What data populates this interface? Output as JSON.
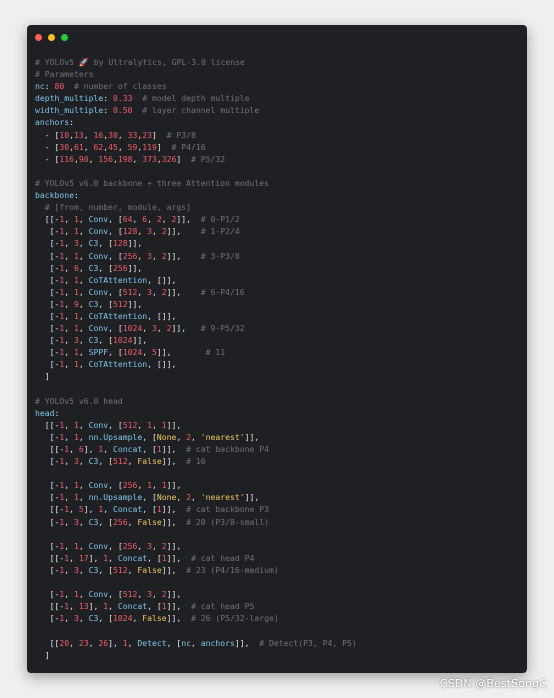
{
  "window": {
    "controls": [
      {
        "name": "close-dot",
        "color": "#ff5f56"
      },
      {
        "name": "minimize-dot",
        "color": "#ffbd2e"
      },
      {
        "name": "maximize-dot",
        "color": "#27c93f"
      }
    ]
  },
  "theme": {
    "background": "#1f2023",
    "comment": "#6f7379",
    "key": "#7fc6ee",
    "number": "#f25d67",
    "string": "#f0c75c",
    "text": "#e1e3e5"
  },
  "code_lines": [
    [
      [
        "c",
        "# YOLOv5 "
      ],
      [
        "e",
        "🚀"
      ],
      [
        "c",
        " by Ultralytics, GPL-3.0 license"
      ]
    ],
    [
      [
        "c",
        "# Parameters"
      ]
    ],
    [
      [
        "k",
        "nc"
      ],
      [
        "p",
        ": "
      ],
      [
        "n",
        "80"
      ],
      [
        "p",
        "  "
      ],
      [
        "c",
        "# number of classes"
      ]
    ],
    [
      [
        "k",
        "depth_multiple"
      ],
      [
        "p",
        ": "
      ],
      [
        "n",
        "0.33"
      ],
      [
        "p",
        "  "
      ],
      [
        "c",
        "# model depth multiple"
      ]
    ],
    [
      [
        "k",
        "width_multiple"
      ],
      [
        "p",
        ": "
      ],
      [
        "n",
        "0.50"
      ],
      [
        "p",
        "  "
      ],
      [
        "c",
        "# layer channel multiple"
      ]
    ],
    [
      [
        "k",
        "anchors"
      ],
      [
        "p",
        ":"
      ]
    ],
    [
      [
        "p",
        "  - ["
      ],
      [
        "n",
        "10"
      ],
      [
        "p",
        ","
      ],
      [
        "n",
        "13"
      ],
      [
        "p",
        ", "
      ],
      [
        "n",
        "16"
      ],
      [
        "p",
        ","
      ],
      [
        "n",
        "30"
      ],
      [
        "p",
        ", "
      ],
      [
        "n",
        "33"
      ],
      [
        "p",
        ","
      ],
      [
        "n",
        "23"
      ],
      [
        "p",
        "]  "
      ],
      [
        "c",
        "# P3/8"
      ]
    ],
    [
      [
        "p",
        "  - ["
      ],
      [
        "n",
        "30"
      ],
      [
        "p",
        ","
      ],
      [
        "n",
        "61"
      ],
      [
        "p",
        ", "
      ],
      [
        "n",
        "62"
      ],
      [
        "p",
        ","
      ],
      [
        "n",
        "45"
      ],
      [
        "p",
        ", "
      ],
      [
        "n",
        "59"
      ],
      [
        "p",
        ","
      ],
      [
        "n",
        "119"
      ],
      [
        "p",
        "]  "
      ],
      [
        "c",
        "# P4/16"
      ]
    ],
    [
      [
        "p",
        "  - ["
      ],
      [
        "n",
        "116"
      ],
      [
        "p",
        ","
      ],
      [
        "n",
        "90"
      ],
      [
        "p",
        ", "
      ],
      [
        "n",
        "156"
      ],
      [
        "p",
        ","
      ],
      [
        "n",
        "198"
      ],
      [
        "p",
        ", "
      ],
      [
        "n",
        "373"
      ],
      [
        "p",
        ","
      ],
      [
        "n",
        "326"
      ],
      [
        "p",
        "]  "
      ],
      [
        "c",
        "# P5/32"
      ]
    ],
    [],
    [
      [
        "c",
        "# YOLOv5 v6.0 backbone + three Attention modules"
      ]
    ],
    [
      [
        "k",
        "backbone"
      ],
      [
        "p",
        ":"
      ]
    ],
    [
      [
        "p",
        "  "
      ],
      [
        "c",
        "# [from, number, module, args]"
      ]
    ],
    [
      [
        "p",
        "  [[-"
      ],
      [
        "n",
        "1"
      ],
      [
        "p",
        ", "
      ],
      [
        "n",
        "1"
      ],
      [
        "p",
        ", "
      ],
      [
        "f",
        "Conv"
      ],
      [
        "p",
        ", ["
      ],
      [
        "n",
        "64"
      ],
      [
        "p",
        ", "
      ],
      [
        "n",
        "6"
      ],
      [
        "p",
        ", "
      ],
      [
        "n",
        "2"
      ],
      [
        "p",
        ", "
      ],
      [
        "n",
        "2"
      ],
      [
        "p",
        "]],  "
      ],
      [
        "c",
        "# 0-P1/2"
      ]
    ],
    [
      [
        "p",
        "   [-"
      ],
      [
        "n",
        "1"
      ],
      [
        "p",
        ", "
      ],
      [
        "n",
        "1"
      ],
      [
        "p",
        ", "
      ],
      [
        "f",
        "Conv"
      ],
      [
        "p",
        ", ["
      ],
      [
        "n",
        "128"
      ],
      [
        "p",
        ", "
      ],
      [
        "n",
        "3"
      ],
      [
        "p",
        ", "
      ],
      [
        "n",
        "2"
      ],
      [
        "p",
        "]],    "
      ],
      [
        "c",
        "# 1-P2/4"
      ]
    ],
    [
      [
        "p",
        "   [-"
      ],
      [
        "n",
        "1"
      ],
      [
        "p",
        ", "
      ],
      [
        "n",
        "3"
      ],
      [
        "p",
        ", "
      ],
      [
        "f",
        "C3"
      ],
      [
        "p",
        ", ["
      ],
      [
        "n",
        "128"
      ],
      [
        "p",
        "]],"
      ]
    ],
    [
      [
        "p",
        "   [-"
      ],
      [
        "n",
        "1"
      ],
      [
        "p",
        ", "
      ],
      [
        "n",
        "1"
      ],
      [
        "p",
        ", "
      ],
      [
        "f",
        "Conv"
      ],
      [
        "p",
        ", ["
      ],
      [
        "n",
        "256"
      ],
      [
        "p",
        ", "
      ],
      [
        "n",
        "3"
      ],
      [
        "p",
        ", "
      ],
      [
        "n",
        "2"
      ],
      [
        "p",
        "]],    "
      ],
      [
        "c",
        "# 3-P3/8"
      ]
    ],
    [
      [
        "p",
        "   [-"
      ],
      [
        "n",
        "1"
      ],
      [
        "p",
        ", "
      ],
      [
        "n",
        "6"
      ],
      [
        "p",
        ", "
      ],
      [
        "f",
        "C3"
      ],
      [
        "p",
        ", ["
      ],
      [
        "n",
        "256"
      ],
      [
        "p",
        "]],"
      ]
    ],
    [
      [
        "p",
        "   [-"
      ],
      [
        "n",
        "1"
      ],
      [
        "p",
        ", "
      ],
      [
        "n",
        "1"
      ],
      [
        "p",
        ", "
      ],
      [
        "f",
        "CoTAttention"
      ],
      [
        "p",
        ", []],"
      ]
    ],
    [
      [
        "p",
        "   [-"
      ],
      [
        "n",
        "1"
      ],
      [
        "p",
        ", "
      ],
      [
        "n",
        "1"
      ],
      [
        "p",
        ", "
      ],
      [
        "f",
        "Conv"
      ],
      [
        "p",
        ", ["
      ],
      [
        "n",
        "512"
      ],
      [
        "p",
        ", "
      ],
      [
        "n",
        "3"
      ],
      [
        "p",
        ", "
      ],
      [
        "n",
        "2"
      ],
      [
        "p",
        "]],    "
      ],
      [
        "c",
        "# 6-P4/16"
      ]
    ],
    [
      [
        "p",
        "   [-"
      ],
      [
        "n",
        "1"
      ],
      [
        "p",
        ", "
      ],
      [
        "n",
        "9"
      ],
      [
        "p",
        ", "
      ],
      [
        "f",
        "C3"
      ],
      [
        "p",
        ", ["
      ],
      [
        "n",
        "512"
      ],
      [
        "p",
        "]],"
      ]
    ],
    [
      [
        "p",
        "   [-"
      ],
      [
        "n",
        "1"
      ],
      [
        "p",
        ", "
      ],
      [
        "n",
        "1"
      ],
      [
        "p",
        ", "
      ],
      [
        "f",
        "CoTAttention"
      ],
      [
        "p",
        ", []],"
      ]
    ],
    [
      [
        "p",
        "   [-"
      ],
      [
        "n",
        "1"
      ],
      [
        "p",
        ", "
      ],
      [
        "n",
        "1"
      ],
      [
        "p",
        ", "
      ],
      [
        "f",
        "Conv"
      ],
      [
        "p",
        ", ["
      ],
      [
        "n",
        "1024"
      ],
      [
        "p",
        ", "
      ],
      [
        "n",
        "3"
      ],
      [
        "p",
        ", "
      ],
      [
        "n",
        "2"
      ],
      [
        "p",
        "]],   "
      ],
      [
        "c",
        "# 9-P5/32"
      ]
    ],
    [
      [
        "p",
        "   [-"
      ],
      [
        "n",
        "1"
      ],
      [
        "p",
        ", "
      ],
      [
        "n",
        "3"
      ],
      [
        "p",
        ", "
      ],
      [
        "f",
        "C3"
      ],
      [
        "p",
        ", ["
      ],
      [
        "n",
        "1024"
      ],
      [
        "p",
        "]],"
      ]
    ],
    [
      [
        "p",
        "   [-"
      ],
      [
        "n",
        "1"
      ],
      [
        "p",
        ", "
      ],
      [
        "n",
        "1"
      ],
      [
        "p",
        ", "
      ],
      [
        "f",
        "SPPF"
      ],
      [
        "p",
        ", ["
      ],
      [
        "n",
        "1024"
      ],
      [
        "p",
        ", "
      ],
      [
        "n",
        "5"
      ],
      [
        "p",
        "]],       "
      ],
      [
        "c",
        "# 11"
      ]
    ],
    [
      [
        "p",
        "   [-"
      ],
      [
        "n",
        "1"
      ],
      [
        "p",
        ", "
      ],
      [
        "n",
        "1"
      ],
      [
        "p",
        ", "
      ],
      [
        "f",
        "CoTAttention"
      ],
      [
        "p",
        ", []],"
      ]
    ],
    [
      [
        "p",
        "  ]"
      ]
    ],
    [],
    [
      [
        "c",
        "# YOLOv5 v6.0 head"
      ]
    ],
    [
      [
        "k",
        "head"
      ],
      [
        "p",
        ":"
      ]
    ],
    [
      [
        "p",
        "  [[-"
      ],
      [
        "n",
        "1"
      ],
      [
        "p",
        ", "
      ],
      [
        "n",
        "1"
      ],
      [
        "p",
        ", "
      ],
      [
        "f",
        "Conv"
      ],
      [
        "p",
        ", ["
      ],
      [
        "n",
        "512"
      ],
      [
        "p",
        ", "
      ],
      [
        "n",
        "1"
      ],
      [
        "p",
        ", "
      ],
      [
        "n",
        "1"
      ],
      [
        "p",
        "]],"
      ]
    ],
    [
      [
        "p",
        "   [-"
      ],
      [
        "n",
        "1"
      ],
      [
        "p",
        ", "
      ],
      [
        "n",
        "1"
      ],
      [
        "p",
        ", "
      ],
      [
        "f",
        "nn.Upsample"
      ],
      [
        "p",
        ", ["
      ],
      [
        "s",
        "None"
      ],
      [
        "p",
        ", "
      ],
      [
        "n",
        "2"
      ],
      [
        "p",
        ", "
      ],
      [
        "s",
        "'nearest'"
      ],
      [
        "p",
        "]],"
      ]
    ],
    [
      [
        "p",
        "   [[-"
      ],
      [
        "n",
        "1"
      ],
      [
        "p",
        ", "
      ],
      [
        "n",
        "6"
      ],
      [
        "p",
        "], "
      ],
      [
        "n",
        "1"
      ],
      [
        "p",
        ", "
      ],
      [
        "f",
        "Concat"
      ],
      [
        "p",
        ", ["
      ],
      [
        "n",
        "1"
      ],
      [
        "p",
        "]],  "
      ],
      [
        "c",
        "# cat backbone P4"
      ]
    ],
    [
      [
        "p",
        "   [-"
      ],
      [
        "n",
        "1"
      ],
      [
        "p",
        ", "
      ],
      [
        "n",
        "3"
      ],
      [
        "p",
        ", "
      ],
      [
        "f",
        "C3"
      ],
      [
        "p",
        ", ["
      ],
      [
        "n",
        "512"
      ],
      [
        "p",
        ", "
      ],
      [
        "s",
        "False"
      ],
      [
        "p",
        "]],  "
      ],
      [
        "c",
        "# 16"
      ]
    ],
    [],
    [
      [
        "p",
        "   [-"
      ],
      [
        "n",
        "1"
      ],
      [
        "p",
        ", "
      ],
      [
        "n",
        "1"
      ],
      [
        "p",
        ", "
      ],
      [
        "f",
        "Conv"
      ],
      [
        "p",
        ", ["
      ],
      [
        "n",
        "256"
      ],
      [
        "p",
        ", "
      ],
      [
        "n",
        "1"
      ],
      [
        "p",
        ", "
      ],
      [
        "n",
        "1"
      ],
      [
        "p",
        "]],"
      ]
    ],
    [
      [
        "p",
        "   [-"
      ],
      [
        "n",
        "1"
      ],
      [
        "p",
        ", "
      ],
      [
        "n",
        "1"
      ],
      [
        "p",
        ", "
      ],
      [
        "f",
        "nn.Upsample"
      ],
      [
        "p",
        ", ["
      ],
      [
        "s",
        "None"
      ],
      [
        "p",
        ", "
      ],
      [
        "n",
        "2"
      ],
      [
        "p",
        ", "
      ],
      [
        "s",
        "'nearest'"
      ],
      [
        "p",
        "]],"
      ]
    ],
    [
      [
        "p",
        "   [[-"
      ],
      [
        "n",
        "1"
      ],
      [
        "p",
        ", "
      ],
      [
        "n",
        "5"
      ],
      [
        "p",
        "], "
      ],
      [
        "n",
        "1"
      ],
      [
        "p",
        ", "
      ],
      [
        "f",
        "Concat"
      ],
      [
        "p",
        ", ["
      ],
      [
        "n",
        "1"
      ],
      [
        "p",
        "]],  "
      ],
      [
        "c",
        "# cat backbone P3"
      ]
    ],
    [
      [
        "p",
        "   [-"
      ],
      [
        "n",
        "1"
      ],
      [
        "p",
        ", "
      ],
      [
        "n",
        "3"
      ],
      [
        "p",
        ", "
      ],
      [
        "f",
        "C3"
      ],
      [
        "p",
        ", ["
      ],
      [
        "n",
        "256"
      ],
      [
        "p",
        ", "
      ],
      [
        "s",
        "False"
      ],
      [
        "p",
        "]],  "
      ],
      [
        "c",
        "# 20 (P3/8-small)"
      ]
    ],
    [],
    [
      [
        "p",
        "   [-"
      ],
      [
        "n",
        "1"
      ],
      [
        "p",
        ", "
      ],
      [
        "n",
        "1"
      ],
      [
        "p",
        ", "
      ],
      [
        "f",
        "Conv"
      ],
      [
        "p",
        ", ["
      ],
      [
        "n",
        "256"
      ],
      [
        "p",
        ", "
      ],
      [
        "n",
        "3"
      ],
      [
        "p",
        ", "
      ],
      [
        "n",
        "2"
      ],
      [
        "p",
        "]],"
      ]
    ],
    [
      [
        "p",
        "   [[-"
      ],
      [
        "n",
        "1"
      ],
      [
        "p",
        ", "
      ],
      [
        "n",
        "17"
      ],
      [
        "p",
        "], "
      ],
      [
        "n",
        "1"
      ],
      [
        "p",
        ", "
      ],
      [
        "f",
        "Concat"
      ],
      [
        "p",
        ", ["
      ],
      [
        "n",
        "1"
      ],
      [
        "p",
        "]],  "
      ],
      [
        "c",
        "# cat head P4"
      ]
    ],
    [
      [
        "p",
        "   [-"
      ],
      [
        "n",
        "1"
      ],
      [
        "p",
        ", "
      ],
      [
        "n",
        "3"
      ],
      [
        "p",
        ", "
      ],
      [
        "f",
        "C3"
      ],
      [
        "p",
        ", ["
      ],
      [
        "n",
        "512"
      ],
      [
        "p",
        ", "
      ],
      [
        "s",
        "False"
      ],
      [
        "p",
        "]],  "
      ],
      [
        "c",
        "# 23 (P4/16-medium)"
      ]
    ],
    [],
    [
      [
        "p",
        "   [-"
      ],
      [
        "n",
        "1"
      ],
      [
        "p",
        ", "
      ],
      [
        "n",
        "1"
      ],
      [
        "p",
        ", "
      ],
      [
        "f",
        "Conv"
      ],
      [
        "p",
        ", ["
      ],
      [
        "n",
        "512"
      ],
      [
        "p",
        ", "
      ],
      [
        "n",
        "3"
      ],
      [
        "p",
        ", "
      ],
      [
        "n",
        "2"
      ],
      [
        "p",
        "]],"
      ]
    ],
    [
      [
        "p",
        "   [[-"
      ],
      [
        "n",
        "1"
      ],
      [
        "p",
        ", "
      ],
      [
        "n",
        "13"
      ],
      [
        "p",
        "], "
      ],
      [
        "n",
        "1"
      ],
      [
        "p",
        ", "
      ],
      [
        "f",
        "Concat"
      ],
      [
        "p",
        ", ["
      ],
      [
        "n",
        "1"
      ],
      [
        "p",
        "]],  "
      ],
      [
        "c",
        "# cat head P5"
      ]
    ],
    [
      [
        "p",
        "   [-"
      ],
      [
        "n",
        "1"
      ],
      [
        "p",
        ", "
      ],
      [
        "n",
        "3"
      ],
      [
        "p",
        ", "
      ],
      [
        "f",
        "C3"
      ],
      [
        "p",
        ", ["
      ],
      [
        "n",
        "1024"
      ],
      [
        "p",
        ", "
      ],
      [
        "s",
        "False"
      ],
      [
        "p",
        "]],  "
      ],
      [
        "c",
        "# 26 (P5/32-large)"
      ]
    ],
    [],
    [
      [
        "p",
        "   [["
      ],
      [
        "n",
        "20"
      ],
      [
        "p",
        ", "
      ],
      [
        "n",
        "23"
      ],
      [
        "p",
        ", "
      ],
      [
        "n",
        "26"
      ],
      [
        "p",
        "], "
      ],
      [
        "n",
        "1"
      ],
      [
        "p",
        ", "
      ],
      [
        "f",
        "Detect"
      ],
      [
        "p",
        ", ["
      ],
      [
        "k",
        "nc"
      ],
      [
        "p",
        ", "
      ],
      [
        "k",
        "anchors"
      ],
      [
        "p",
        "]],  "
      ],
      [
        "c",
        "# Detect(P3, P4, P5)"
      ]
    ],
    [
      [
        "p",
        "  ]"
      ]
    ]
  ],
  "watermark": "CSDN @BestSongC"
}
